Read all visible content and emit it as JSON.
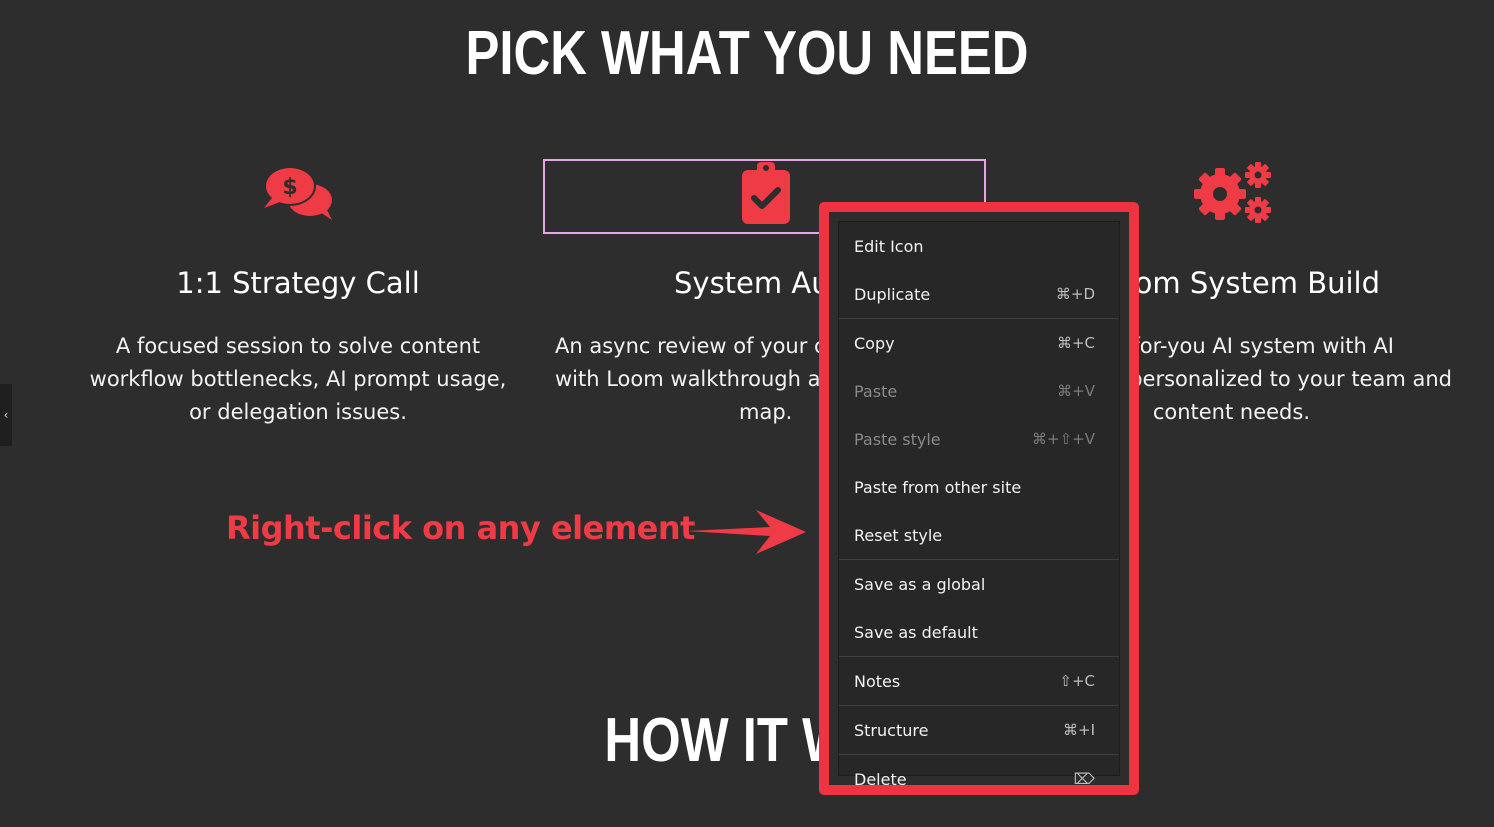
{
  "page": {
    "heading": "PICK WHAT YOU NEED",
    "heading2": "HOW IT WO"
  },
  "columns": [
    {
      "title": "1:1 Strategy Call",
      "description": "A focused session to solve content workflow bottlenecks, AI prompt usage, or delegation issues.",
      "icon": "dollar-chat-icon"
    },
    {
      "title": "System Au",
      "description_lines": [
        "An async review of your c",
        "with Loom walkthrough a",
        "map."
      ],
      "icon": "clipboard-check-icon"
    },
    {
      "title": "tom System Build",
      "description_lines": [
        "for-you AI system with AI",
        "personalized to your team and",
        "content needs."
      ],
      "icon": "gears-icon"
    }
  ],
  "annotation": {
    "text": "Right-click on any element"
  },
  "context_menu": {
    "items": [
      {
        "label": "Edit Icon",
        "shortcut": "",
        "disabled": false
      },
      {
        "label": "Duplicate",
        "shortcut": "⌘+D",
        "disabled": false
      },
      {
        "label": "Copy",
        "shortcut": "⌘+C",
        "disabled": false
      },
      {
        "label": "Paste",
        "shortcut": "⌘+V",
        "disabled": true
      },
      {
        "label": "Paste style",
        "shortcut": "⌘+⇧+V",
        "disabled": true
      },
      {
        "label": "Paste from other site",
        "shortcut": "",
        "disabled": false
      },
      {
        "label": "Reset style",
        "shortcut": "",
        "disabled": false
      },
      {
        "label": "Save as a global",
        "shortcut": "",
        "disabled": false
      },
      {
        "label": "Save as default",
        "shortcut": "",
        "disabled": false
      },
      {
        "label": "Notes",
        "shortcut": "⇧+C",
        "disabled": false
      },
      {
        "label": "Structure",
        "shortcut": "⌘+I",
        "disabled": false
      },
      {
        "label": "Delete",
        "shortcut": "⌦",
        "disabled": false
      }
    ]
  },
  "colors": {
    "accent": "#ef3b45",
    "background": "#2d2d2e",
    "menu_bg": "#272728",
    "selection": "#e6a6e6"
  },
  "side_handle": {
    "glyph": "‹"
  }
}
